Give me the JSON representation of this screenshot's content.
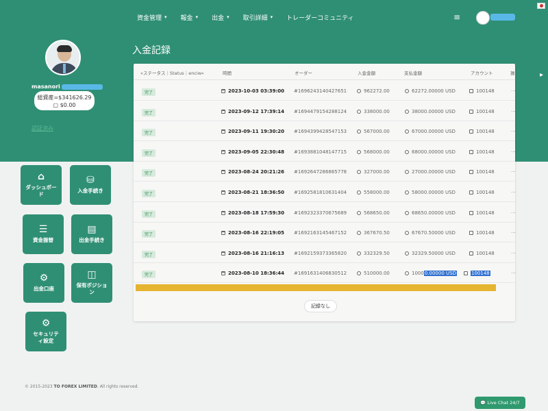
{
  "nav": {
    "items": [
      {
        "label": "資金管理",
        "caret": true
      },
      {
        "label": "報金",
        "caret": true
      },
      {
        "label": "出金",
        "caret": true
      },
      {
        "label": "取引詳細",
        "caret": true
      },
      {
        "label": "トレーダーコミュニティ",
        "caret": false
      }
    ],
    "menu_icon": "hamburger-icon"
  },
  "profile": {
    "name": "masanori",
    "balance_line": "総資産=$341626.29",
    "cash_line": "$0.00",
    "verify_label": "認証済み"
  },
  "page": {
    "title": "入金記録"
  },
  "table": {
    "headers": [
      "«ステータス｜Status｜enciw»",
      "時間",
      "オーダー",
      "入金金額",
      "支払金額",
      "アカウント",
      "操"
    ],
    "rows": [
      {
        "status": "完了",
        "time": "2023-10-03 03:39:00",
        "order": "#1696243140427651",
        "deposit": "962272.00",
        "payment": "62272.00000 USD",
        "account": "100148"
      },
      {
        "status": "完了",
        "time": "2023-09-12 17:39:14",
        "order": "#1694479154288124",
        "deposit": "338000.00",
        "payment": "38000.00000 USD",
        "account": "100148"
      },
      {
        "status": "完了",
        "time": "2023-09-11 19:30:20",
        "order": "#1694399428547153",
        "deposit": "567000.00",
        "payment": "67000.00000 USD",
        "account": "100148"
      },
      {
        "status": "完了",
        "time": "2023-09-05 22:30:48",
        "order": "#1693881048147715",
        "deposit": "568000.00",
        "payment": "68000.00000 USD",
        "account": "100148"
      },
      {
        "status": "完了",
        "time": "2023-08-24 20:21:26",
        "order": "#1692647286865778",
        "deposit": "327000.00",
        "payment": "27000.00000 USD",
        "account": "100148"
      },
      {
        "status": "完了",
        "time": "2023-08-21 18:36:50",
        "order": "#1692581810631404",
        "deposit": "558000.00",
        "payment": "58000.00000 USD",
        "account": "100148"
      },
      {
        "status": "完了",
        "time": "2023-08-18 17:59:30",
        "order": "#1692323370675689",
        "deposit": "568650.00",
        "payment": "68650.00000 USD",
        "account": "100148"
      },
      {
        "status": "完了",
        "time": "2023-08-16 22:19:05",
        "order": "#1692163145467152",
        "deposit": "367670.50",
        "payment": "67670.50000 USD",
        "account": "100148"
      },
      {
        "status": "完了",
        "time": "2023-08-16 21:16:13",
        "order": "#1692159373365820",
        "deposit": "332329.50",
        "payment": "32329.50000 USD",
        "account": "100148"
      },
      {
        "status": "完了",
        "time": "2023-08-10 18:36:44",
        "order": "#1691631406830512",
        "deposit": "510000.00",
        "payment_pre": "1000",
        "payment_sel": "0.00000 USD",
        "account": "100148"
      }
    ],
    "row_dots": "···",
    "no_records": "記録なし"
  },
  "sidebar": {
    "buttons": [
      {
        "label": "ダッシュボード",
        "icon": "home-icon"
      },
      {
        "label": "入金手続き",
        "icon": "deposit-icon"
      },
      {
        "label": "資金振替",
        "icon": "list-icon"
      },
      {
        "label": "出金手続き",
        "icon": "document-icon"
      },
      {
        "label": "出金口座",
        "icon": "gears-icon"
      },
      {
        "label": "保有ポジション",
        "icon": "book-icon"
      },
      {
        "label": "セキュリティ設定",
        "icon": "gear-icon"
      }
    ]
  },
  "footer": {
    "prefix": "© 2015-2023 ",
    "brand": "TO FOREX LIMITED",
    "suffix": ". All rights reserved."
  },
  "live_chat": "Live Chat 24/7",
  "colors": {
    "brand_green": "#2f8f74",
    "status_green": "#2e8b57",
    "highlight_bar": "#e5b430",
    "selection": "#2f6fd0"
  }
}
